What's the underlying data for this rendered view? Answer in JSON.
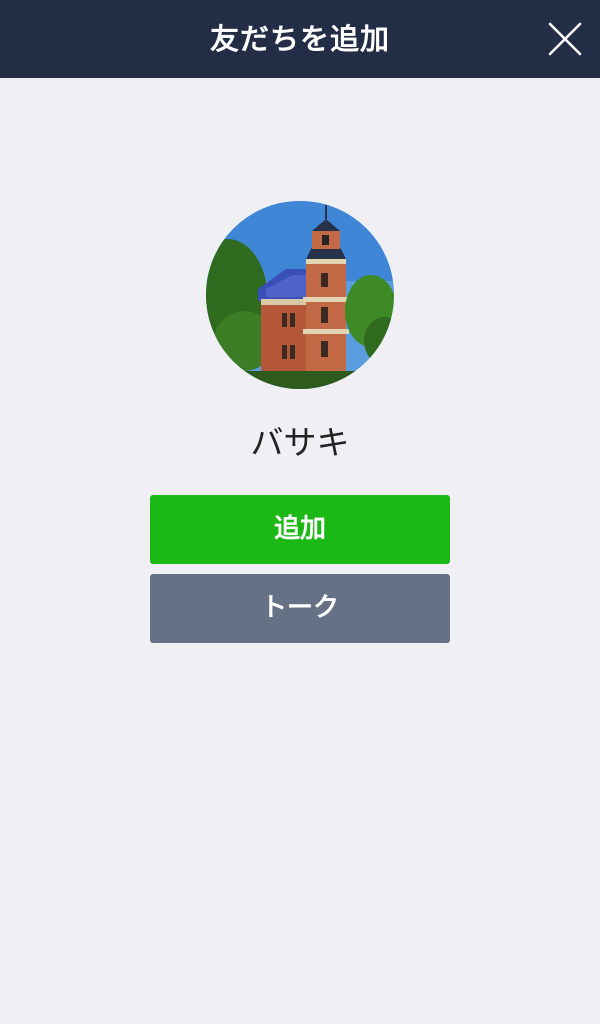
{
  "header": {
    "title": "友だちを追加",
    "close_icon": "close-icon"
  },
  "profile": {
    "name": "バサキ",
    "avatar_icon": "building-photo"
  },
  "actions": {
    "add_label": "追加",
    "talk_label": "トーク"
  },
  "colors": {
    "header_bg": "#232d46",
    "page_bg": "#efeff4",
    "add_button": "#1cb816",
    "talk_button": "#677185"
  }
}
